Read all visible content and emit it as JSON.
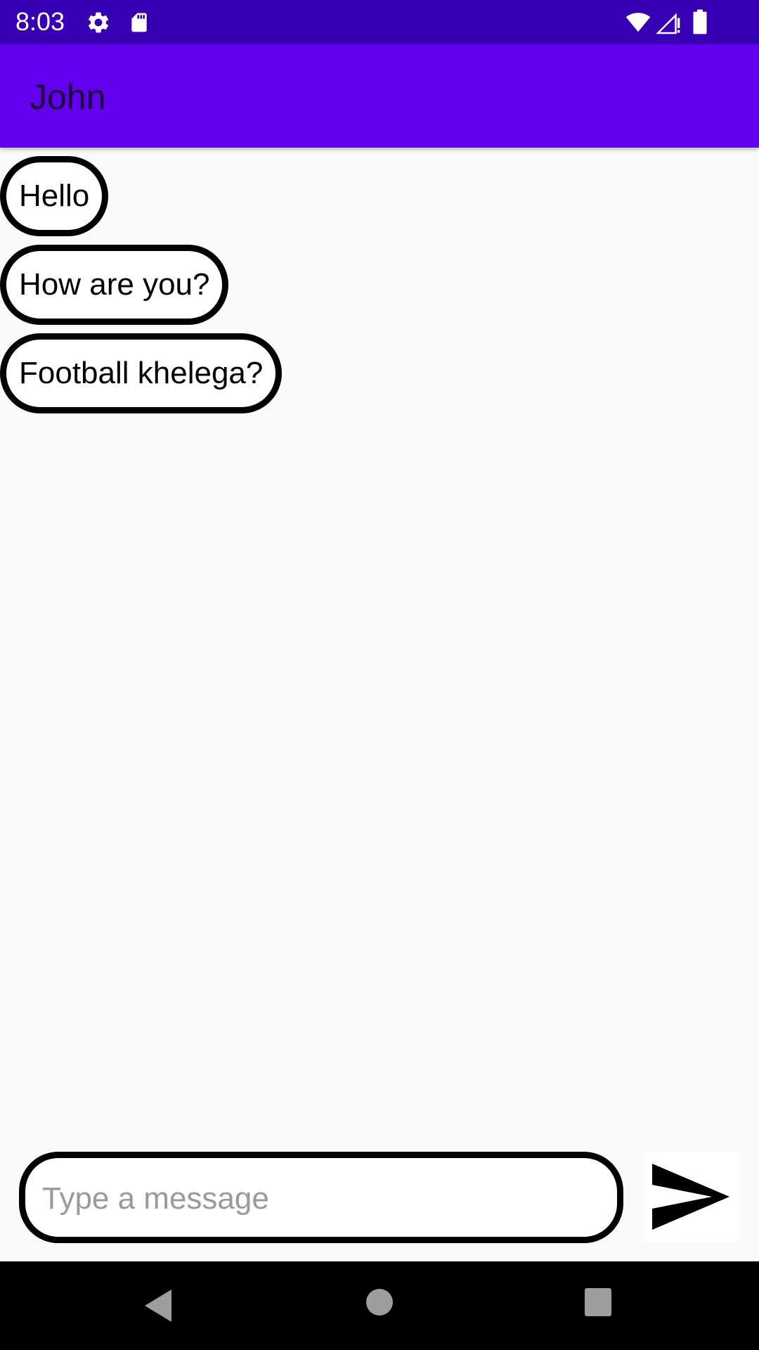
{
  "status_bar": {
    "time": "8:03",
    "icons": [
      "gear-icon",
      "sd-card-icon",
      "wifi-icon",
      "cell-signal-icon",
      "battery-icon"
    ],
    "background": "#3700b3"
  },
  "app_bar": {
    "title": "John",
    "background": "#6200ee"
  },
  "messages": [
    {
      "text": "Hello"
    },
    {
      "text": "How are you?"
    },
    {
      "text": "Football khelega?"
    }
  ],
  "composer": {
    "placeholder": "Type a message",
    "send_icon": "send-icon"
  },
  "nav_bar": {
    "icons": [
      "back-icon",
      "home-icon",
      "recents-icon"
    ]
  }
}
